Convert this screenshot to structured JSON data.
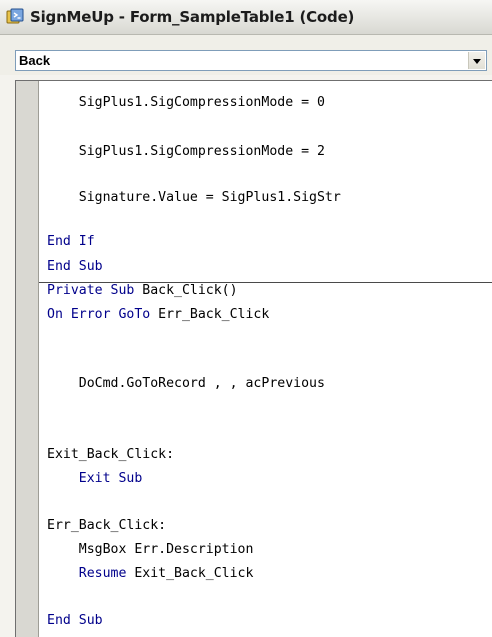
{
  "window": {
    "title": "SignMeUp - Form_SampleTable1 (Code)",
    "icon": "code-window-icon"
  },
  "procedure_combo": {
    "value": "Back",
    "dropdown_icon": "chevron-down-icon"
  },
  "code": {
    "lines": [
      {
        "indent": "    ",
        "kw": "",
        "text": "SigPlus1.SigCompressionMode = 0"
      },
      {
        "indent": "    ",
        "kw": "",
        "text": "SigPlus1.SigCompressionMode = 2"
      },
      {
        "indent": "    ",
        "kw": "",
        "text": "Signature.Value = SigPlus1.SigStr"
      },
      {
        "indent": "",
        "kw": "End If",
        "text": ""
      },
      {
        "indent": "",
        "kw": "End Sub",
        "text": ""
      },
      {
        "indent": "",
        "kw": "Private Sub",
        "text": " Back_Click()"
      },
      {
        "indent": "",
        "kw": "On Error GoTo",
        "text": " Err_Back_Click"
      },
      {
        "indent": "    ",
        "kw": "",
        "text": "DoCmd.GoToRecord , , acPrevious"
      },
      {
        "indent": "",
        "kw": "",
        "text": "Exit_Back_Click:"
      },
      {
        "indent": "    ",
        "kw": "Exit Sub",
        "text": ""
      },
      {
        "indent": "",
        "kw": "",
        "text": "Err_Back_Click:"
      },
      {
        "indent": "    ",
        "kw": "",
        "text": "MsgBox Err.Description"
      },
      {
        "indent": "    ",
        "kw": "Resume",
        "text": " Exit_Back_Click"
      },
      {
        "indent": "",
        "kw": "End Sub",
        "text": ""
      }
    ]
  },
  "colors": {
    "keyword": "#00008b",
    "text": "#000000",
    "margin": "#d9d8d2"
  }
}
